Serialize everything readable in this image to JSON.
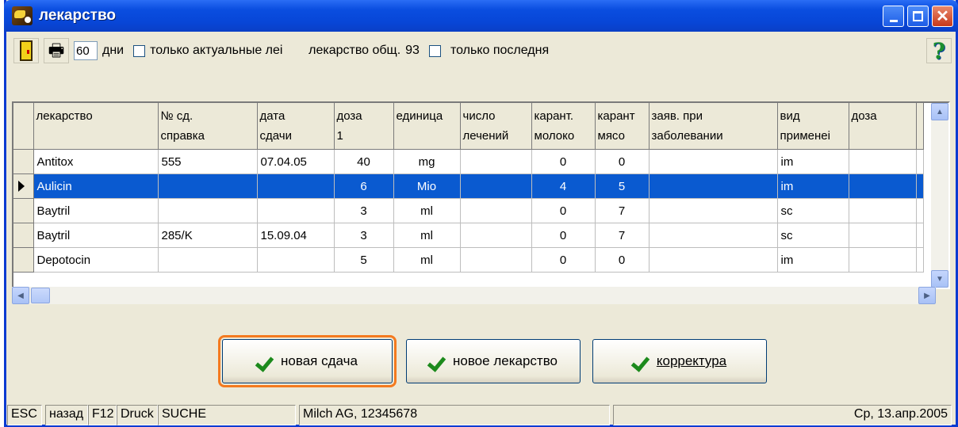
{
  "window": {
    "title": "лекарство"
  },
  "toolbar": {
    "days_value": "60",
    "days_label": "дни",
    "only_current_label": "только актуальные леі",
    "total_label": "лекарство общ.",
    "total_count": "93",
    "only_last_label": "только последня"
  },
  "table": {
    "columns": [
      "лекарство",
      "№ сд.\nсправка",
      "дата\nсдачи",
      "доза\n1",
      "единица",
      "число\nлечений",
      "карант.\nмолоко",
      "карант\nмясо",
      "заяв. при\nзаболевании",
      "вид\nприменеі",
      "доза"
    ],
    "rows": [
      [
        "Antitox",
        "555",
        "07.04.05",
        "40",
        "mg",
        "",
        "0",
        "0",
        "",
        "im",
        ""
      ],
      [
        "Aulicin",
        "",
        "",
        "6",
        "Mio",
        "",
        "4",
        "5",
        "",
        "im",
        ""
      ],
      [
        "Baytril",
        "",
        "",
        "3",
        "ml",
        "",
        "0",
        "7",
        "",
        "sc",
        ""
      ],
      [
        "Baytril",
        "285/K",
        "15.09.04",
        "3",
        "ml",
        "",
        "0",
        "7",
        "",
        "sc",
        ""
      ],
      [
        "Depotocin",
        "",
        "",
        "5",
        "ml",
        "",
        "0",
        "0",
        "",
        "im",
        ""
      ]
    ],
    "selected_row": 1
  },
  "actions": {
    "new_delivery": "новая сдача",
    "new_drug": "новое лекарство",
    "correction": "корректура"
  },
  "status": {
    "esc": "ESC",
    "back": "назад",
    "f12": "F12",
    "druck": "Druck",
    "suche": "SUCHE",
    "company": "Milch AG, 12345678",
    "date": "Ср, 13.апр.2005"
  },
  "colors": {
    "title_bar": "#0a4ee0",
    "selection": "#0a5ad0",
    "focus_outline": "#f47a1f",
    "check": "#1c8a1c"
  }
}
